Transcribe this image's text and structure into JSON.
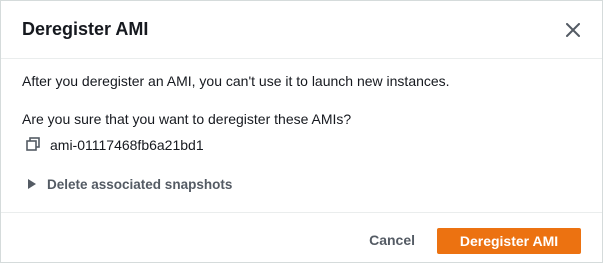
{
  "dialog": {
    "title": "Deregister AMI",
    "close_icon": "close-icon"
  },
  "body": {
    "info_text": "After you deregister an AMI, you can't use it to launch new instances.",
    "confirm_text": "Are you sure that you want to deregister these AMIs?",
    "amis": [
      {
        "id": "ami-01117468fb6a21bd1",
        "icon": "copy-icon"
      }
    ],
    "expander": {
      "label": "Delete associated snapshots",
      "icon": "caret-right-icon",
      "expanded": false
    }
  },
  "footer": {
    "cancel_label": "Cancel",
    "submit_label": "Deregister AMI"
  },
  "colors": {
    "primary_button": "#ec7211",
    "text": "#16191f",
    "secondary_text": "#545b64",
    "border": "#d5dbdb"
  }
}
